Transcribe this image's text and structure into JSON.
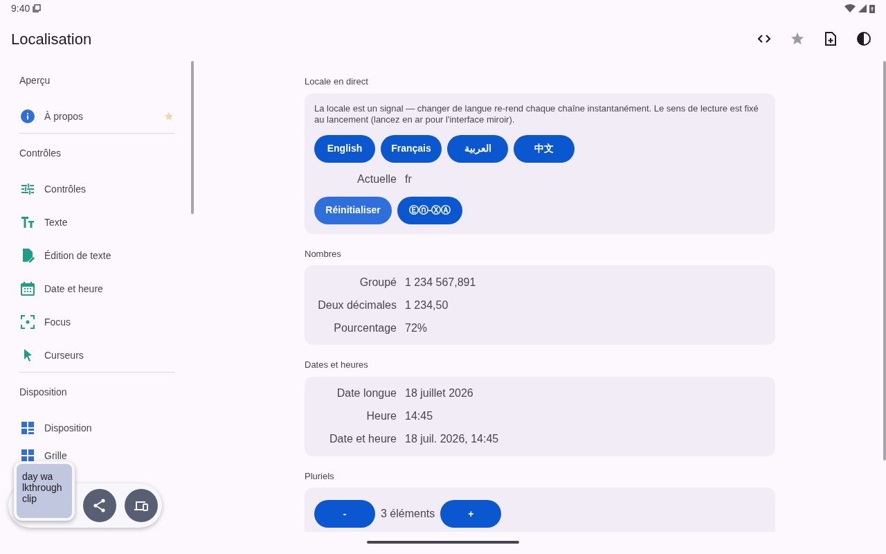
{
  "status_bar": {
    "time": "9:40"
  },
  "app_bar": {
    "title": "Localisation"
  },
  "sidebar": {
    "sections": [
      {
        "title": "Aperçu",
        "items": [
          {
            "label": "À propos",
            "starred": true
          }
        ]
      },
      {
        "title": "Contrôles",
        "items": [
          {
            "label": "Contrôles",
            "starred": false
          },
          {
            "label": "Texte",
            "starred": false
          },
          {
            "label": "Édition de texte",
            "starred": false
          },
          {
            "label": "Date et heure",
            "starred": false
          },
          {
            "label": "Focus",
            "starred": false
          },
          {
            "label": "Curseurs",
            "starred": false
          }
        ]
      },
      {
        "title": "Disposition",
        "items": [
          {
            "label": "Disposition",
            "starred": false
          },
          {
            "label": "Grille",
            "starred": false
          }
        ]
      }
    ]
  },
  "sections": [
    {
      "title": "Locale en direct",
      "kind": "locale",
      "description": "La locale est un signal — changer de langue re-rend chaque chaîne instantanément. Le sens de lecture est fixé au lancement (lancez en ar pour l'interface miroir).",
      "languages": [
        {
          "label": "English"
        },
        {
          "label": "Français"
        },
        {
          "label": "العربية"
        },
        {
          "label": "中文"
        }
      ],
      "rows": [
        {
          "label": "Actuelle",
          "value": "fr"
        }
      ],
      "actions": [
        {
          "label": "Réinitialiser",
          "highlighted": true
        },
        {
          "label": "Ⓔⓝ-ⓍⒶ",
          "highlighted": false
        }
      ]
    },
    {
      "title": "Nombres",
      "kind": "rows",
      "rows": [
        {
          "label": "Groupé",
          "value": "1 234 567,891"
        },
        {
          "label": "Deux décimales",
          "value": "1 234,50"
        },
        {
          "label": "Pourcentage",
          "value": "72%"
        }
      ]
    },
    {
      "title": "Dates et heures",
      "kind": "rows",
      "rows": [
        {
          "label": "Date longue",
          "value": "18 juillet 2026"
        },
        {
          "label": "Heure",
          "value": "14:45"
        },
        {
          "label": "Date et heure",
          "value": "18 juil. 2026, 14:45"
        }
      ]
    },
    {
      "title": "Pluriels",
      "kind": "plural",
      "minus": "-",
      "count": "3 éléments",
      "plus": "+"
    }
  ],
  "overlay": {
    "clip_label": "day wa lkthrough clip"
  }
}
